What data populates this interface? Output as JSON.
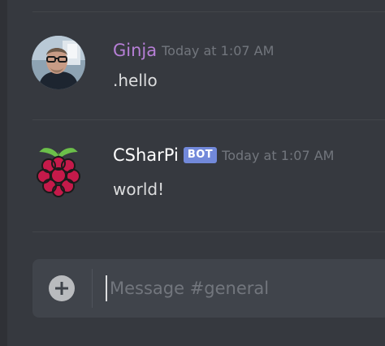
{
  "colors": {
    "background": "#36393f",
    "ginja_name": "#b67fd6",
    "bot_name": "#ffffff",
    "bot_badge": "#7289da",
    "timestamp": "#72767d",
    "message_text": "#dcddde"
  },
  "messages": [
    {
      "username": "Ginja",
      "timestamp": "Today at 1:07 AM",
      "content": ".hello",
      "avatar_icon": "user-photo-avatar"
    },
    {
      "username": "CSharPi",
      "badge": "BOT",
      "timestamp": "Today at 1:07 AM",
      "content": "world!",
      "avatar_icon": "raspberry-pi-logo"
    }
  ],
  "composer": {
    "placeholder": "Message #general",
    "add_icon": "plus-circle-icon"
  }
}
